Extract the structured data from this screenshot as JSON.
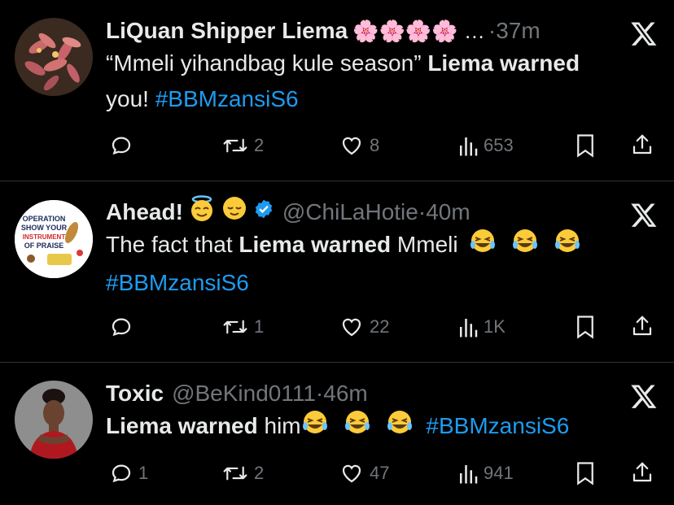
{
  "tweets": [
    {
      "name": "LiQuan Shipper Liema",
      "name_suffix": "🌸🌸🌸🌸 …",
      "handle": "",
      "time": "37m",
      "text_a": "“Mmeli yihandbag kule season” ",
      "bold_a": "Liema warned",
      "text_b": "you! ",
      "hashtag": "#BBMzansiS6",
      "replies": "",
      "reposts": "2",
      "likes": "8",
      "views": "653"
    },
    {
      "name": "Ahead!",
      "handle": "@ChiLaHotie",
      "time": "40m",
      "text_a": "The fact that ",
      "bold_a": "Liema warned",
      "text_b": " Mmeli",
      "hashtag": "#BBMzansiS6",
      "avatar_text": [
        "OPERATION",
        "SHOW YOUR",
        "INSTRUMENT",
        "OF PRAISE"
      ],
      "replies": "",
      "reposts": "1",
      "likes": "22",
      "views": "1K"
    },
    {
      "name": "Toxic",
      "handle": "@BeKind0111",
      "time": "46m",
      "bold_a": "Liema warned",
      "text_b": " him",
      "hashtag": "#BBMzansiS6",
      "replies": "1",
      "reposts": "2",
      "likes": "47",
      "views": "941"
    }
  ],
  "separator": "·",
  "colors": {
    "background": "#000000",
    "text": "#e7e9ea",
    "muted": "#71767b",
    "link": "#1d9bf0",
    "verified": "#1d9bf0"
  }
}
